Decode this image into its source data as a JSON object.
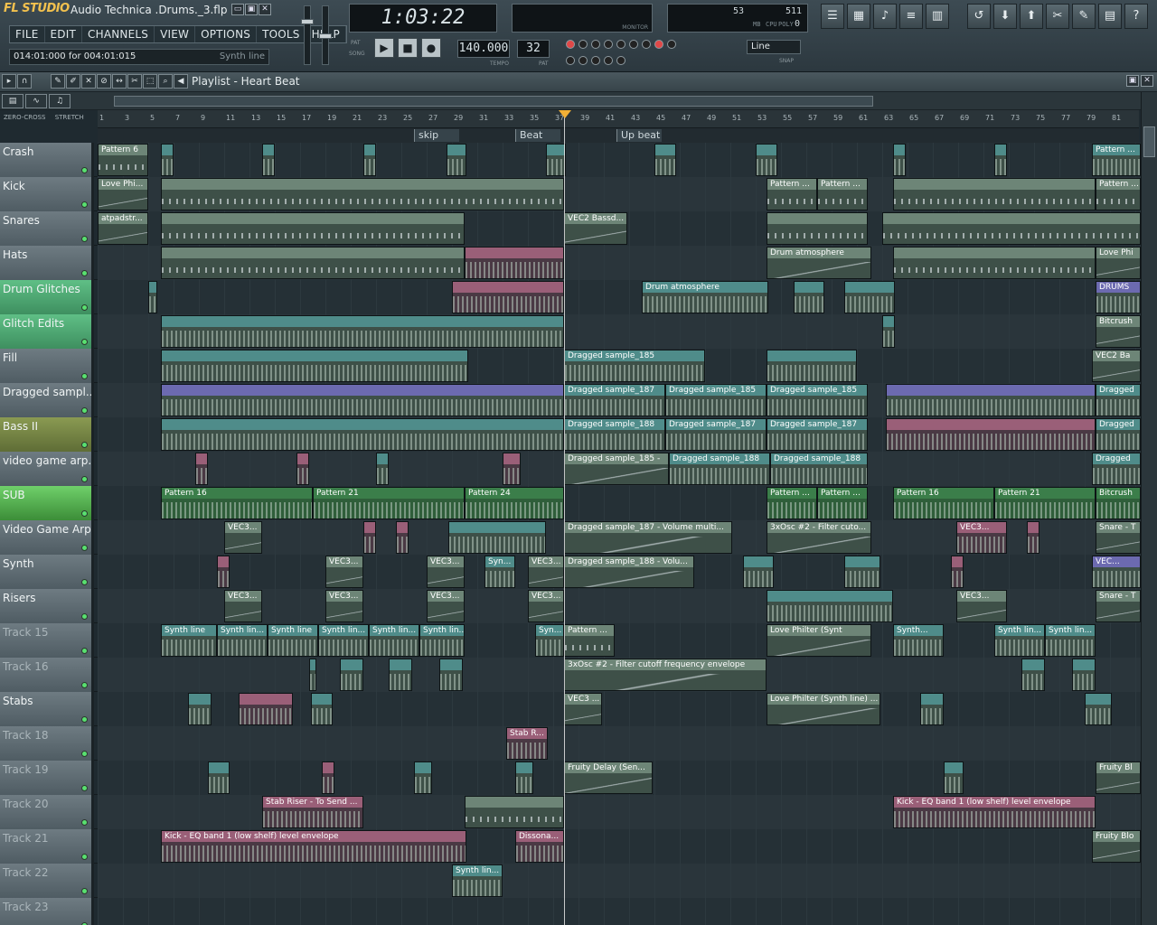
{
  "app": {
    "logo": "FL STUDIO",
    "filename": "Audio Technica .Drums._3.flp"
  },
  "menu": [
    "FILE",
    "EDIT",
    "CHANNELS",
    "VIEW",
    "OPTIONS",
    "TOOLS",
    "HELP"
  ],
  "hint": {
    "text": "014:01:000 for 004:01:015",
    "right": "Synth line"
  },
  "transport": {
    "time": "1:03:22",
    "tempo": "140.000",
    "pattern": "32",
    "tempo_label": "TEMPO",
    "pat_label": "PAT",
    "pat_song_labels": [
      "PAT",
      "SONG"
    ],
    "monitor_label": "MONITOR",
    "cpu_values": [
      "53",
      "511",
      "0"
    ],
    "cpu_labels": [
      "MB",
      "CPU",
      "POLY"
    ],
    "snap_value": "Line",
    "snap_label": "SNAP"
  },
  "playlist": {
    "title": "Playlist - Heart Beat",
    "zero_cross": "ZERO-CROSS",
    "stretch": "STRETCH",
    "markers": [
      {
        "label": "skip",
        "bar": 25
      },
      {
        "label": "Beat Down",
        "bar": 33
      },
      {
        "label": "Up beat",
        "bar": 41
      }
    ],
    "ruler": [
      "1",
      "3",
      "5",
      "7",
      "9",
      "11",
      "13",
      "15",
      "17",
      "19",
      "21",
      "23",
      "25",
      "27",
      "29",
      "31",
      "33",
      "35",
      "37",
      "39",
      "41",
      "43",
      "45",
      "47",
      "49",
      "51",
      "53",
      "55",
      "57",
      "59",
      "61",
      "63",
      "65",
      "67",
      "69",
      "71",
      "73",
      "75",
      "77",
      "79",
      "81"
    ]
  },
  "tracks": [
    {
      "name": "Crash",
      "color": "grey",
      "clips": [
        {
          "label": "Pattern 6",
          "start": 0,
          "len": 56,
          "kind": "pat"
        },
        {
          "label": "",
          "start": 70,
          "len": 14,
          "kind": "teal"
        },
        {
          "label": "",
          "start": 182,
          "len": 14,
          "kind": "teal"
        },
        {
          "label": "",
          "start": 294,
          "len": 14,
          "kind": "teal"
        },
        {
          "label": "",
          "start": 386,
          "len": 22,
          "kind": "teal"
        },
        {
          "label": "",
          "start": 496,
          "len": 22,
          "kind": "teal"
        },
        {
          "label": "",
          "start": 616,
          "len": 24,
          "kind": "teal"
        },
        {
          "label": "",
          "start": 728,
          "len": 24,
          "kind": "teal"
        },
        {
          "label": "",
          "start": 880,
          "len": 14,
          "kind": "teal"
        },
        {
          "label": "",
          "start": 992,
          "len": 14,
          "kind": "teal"
        },
        {
          "label": "Pattern ...",
          "start": 1100,
          "len": 54,
          "kind": "teal"
        }
      ]
    },
    {
      "name": "Kick",
      "color": "grey",
      "clips": [
        {
          "label": "Love Phi...",
          "start": 0,
          "len": 56,
          "kind": "auto"
        },
        {
          "label": "",
          "start": 70,
          "len": 446,
          "kind": "pat"
        },
        {
          "label": "Pattern ...",
          "start": 740,
          "len": 56,
          "kind": "pat"
        },
        {
          "label": "Pattern ...",
          "start": 796,
          "len": 56,
          "kind": "pat"
        },
        {
          "label": "",
          "start": 880,
          "len": 224,
          "kind": "pat"
        },
        {
          "label": "Pattern ...",
          "start": 1104,
          "len": 50,
          "kind": "pat"
        }
      ]
    },
    {
      "name": "Snares",
      "color": "grey",
      "clips": [
        {
          "label": "atpadstr...",
          "start": 0,
          "len": 56,
          "kind": "auto"
        },
        {
          "label": "",
          "start": 70,
          "len": 336,
          "kind": "pat"
        },
        {
          "label": "VEC2 Bassd...",
          "start": 516,
          "len": 70,
          "kind": "auto"
        },
        {
          "label": "",
          "start": 740,
          "len": 112,
          "kind": "pat"
        },
        {
          "label": "",
          "start": 868,
          "len": 286,
          "kind": "pat"
        }
      ]
    },
    {
      "name": "Hats",
      "color": "grey",
      "clips": [
        {
          "label": "",
          "start": 70,
          "len": 336,
          "kind": "pat"
        },
        {
          "label": "",
          "start": 406,
          "len": 110,
          "kind": "pink"
        },
        {
          "label": "Drum atmosphere",
          "start": 740,
          "len": 116,
          "kind": "auto"
        },
        {
          "label": "",
          "start": 880,
          "len": 224,
          "kind": "pat"
        },
        {
          "label": "Love Phi",
          "start": 1104,
          "len": 50,
          "kind": "auto"
        }
      ]
    },
    {
      "name": "Drum Glitches",
      "color": "green",
      "clips": [
        {
          "label": "",
          "start": 56,
          "len": 10,
          "kind": "teal"
        },
        {
          "label": "",
          "start": 392,
          "len": 124,
          "kind": "pink"
        },
        {
          "label": "Drum atmosphere",
          "start": 602,
          "len": 140,
          "kind": "teal"
        },
        {
          "label": "",
          "start": 770,
          "len": 34,
          "kind": "teal"
        },
        {
          "label": "",
          "start": 826,
          "len": 56,
          "kind": "teal"
        },
        {
          "label": "DRUMS",
          "start": 1104,
          "len": 50,
          "kind": "purple"
        }
      ]
    },
    {
      "name": "Glitch Edits",
      "color": "green",
      "clips": [
        {
          "label": "",
          "start": 70,
          "len": 446,
          "kind": "teal"
        },
        {
          "label": "",
          "start": 868,
          "len": 14,
          "kind": "teal"
        },
        {
          "label": "Bitcrush",
          "start": 1104,
          "len": 50,
          "kind": "auto"
        }
      ]
    },
    {
      "name": "Fill",
      "color": "grey",
      "clips": [
        {
          "label": "",
          "start": 70,
          "len": 340,
          "kind": "teal"
        },
        {
          "label": "Dragged sample_185",
          "start": 516,
          "len": 156,
          "kind": "teal"
        },
        {
          "label": "",
          "start": 740,
          "len": 100,
          "kind": "teal"
        },
        {
          "label": "VEC2 Ba",
          "start": 1100,
          "len": 54,
          "kind": "auto"
        }
      ]
    },
    {
      "name": "Dragged sampl...",
      "color": "grey",
      "clips": [
        {
          "label": "",
          "start": 70,
          "len": 446,
          "kind": "purple"
        },
        {
          "label": "Dragged sample_187",
          "start": 516,
          "len": 112,
          "kind": "teal"
        },
        {
          "label": "Dragged sample_185",
          "start": 628,
          "len": 112,
          "kind": "teal"
        },
        {
          "label": "Dragged sample_185",
          "start": 740,
          "len": 112,
          "kind": "teal"
        },
        {
          "label": "",
          "start": 872,
          "len": 232,
          "kind": "purple"
        },
        {
          "label": "Dragged",
          "start": 1104,
          "len": 50,
          "kind": "teal"
        }
      ]
    },
    {
      "name": "Bass II",
      "color": "olive",
      "clips": [
        {
          "label": "",
          "start": 70,
          "len": 446,
          "kind": "teal"
        },
        {
          "label": "Dragged sample_188",
          "start": 516,
          "len": 112,
          "kind": "teal"
        },
        {
          "label": "Dragged sample_187",
          "start": 628,
          "len": 112,
          "kind": "teal"
        },
        {
          "label": "Dragged sample_187",
          "start": 740,
          "len": 112,
          "kind": "teal"
        },
        {
          "label": "",
          "start": 872,
          "len": 232,
          "kind": "pink"
        },
        {
          "label": "Dragged",
          "start": 1104,
          "len": 50,
          "kind": "teal"
        }
      ]
    },
    {
      "name": "video game arp...",
      "color": "pink",
      "clips": [
        {
          "label": "",
          "start": 108,
          "len": 14,
          "kind": "pink"
        },
        {
          "label": "",
          "start": 220,
          "len": 14,
          "kind": "pink"
        },
        {
          "label": "",
          "start": 308,
          "len": 14,
          "kind": "teal"
        },
        {
          "label": "",
          "start": 448,
          "len": 20,
          "kind": "pink"
        },
        {
          "label": "Dragged sample_185 -",
          "start": 516,
          "len": 116,
          "kind": "auto"
        },
        {
          "label": "Dragged sample_188",
          "start": 632,
          "len": 112,
          "kind": "teal"
        },
        {
          "label": "Dragged sample_188",
          "start": 744,
          "len": 108,
          "kind": "teal"
        },
        {
          "label": "Dragged",
          "start": 1100,
          "len": 54,
          "kind": "teal"
        }
      ]
    },
    {
      "name": "SUB",
      "color": "brightgreen",
      "clips": [
        {
          "label": "Pattern 16",
          "start": 70,
          "len": 168,
          "kind": "sub"
        },
        {
          "label": "Pattern 21",
          "start": 238,
          "len": 168,
          "kind": "sub"
        },
        {
          "label": "Pattern 24",
          "start": 406,
          "len": 110,
          "kind": "sub"
        },
        {
          "label": "Pattern ...",
          "start": 740,
          "len": 56,
          "kind": "sub"
        },
        {
          "label": "Pattern ...",
          "start": 796,
          "len": 56,
          "kind": "sub"
        },
        {
          "label": "Pattern 16",
          "start": 880,
          "len": 112,
          "kind": "sub"
        },
        {
          "label": "Pattern 21",
          "start": 992,
          "len": 112,
          "kind": "sub"
        },
        {
          "label": "Bitcrush",
          "start": 1104,
          "len": 50,
          "kind": "sub"
        }
      ]
    },
    {
      "name": "Video Game Arp",
      "color": "grey",
      "clips": [
        {
          "label": "VEC3...",
          "start": 140,
          "len": 42,
          "kind": "auto"
        },
        {
          "label": "",
          "start": 294,
          "len": 14,
          "kind": "pink"
        },
        {
          "label": "",
          "start": 330,
          "len": 14,
          "kind": "pink"
        },
        {
          "label": "",
          "start": 388,
          "len": 108,
          "kind": "teal"
        },
        {
          "label": "Dragged sample_187 - Volume multi...",
          "start": 516,
          "len": 186,
          "kind": "auto"
        },
        {
          "label": "3xOsc #2 - Filter cuto...",
          "start": 740,
          "len": 116,
          "kind": "auto"
        },
        {
          "label": "VEC3...",
          "start": 950,
          "len": 56,
          "kind": "pink"
        },
        {
          "label": "",
          "start": 1028,
          "len": 14,
          "kind": "pink"
        },
        {
          "label": "Snare - T",
          "start": 1104,
          "len": 50,
          "kind": "auto"
        }
      ]
    },
    {
      "name": "Synth",
      "color": "grey",
      "clips": [
        {
          "label": "",
          "start": 132,
          "len": 14,
          "kind": "pink"
        },
        {
          "label": "VEC3...",
          "start": 252,
          "len": 42,
          "kind": "auto"
        },
        {
          "label": "VEC3...",
          "start": 364,
          "len": 42,
          "kind": "auto"
        },
        {
          "label": "Syn...",
          "start": 428,
          "len": 34,
          "kind": "teal"
        },
        {
          "label": "VEC3...",
          "start": 476,
          "len": 40,
          "kind": "auto"
        },
        {
          "label": "Dragged sample_188 - Volu...",
          "start": 516,
          "len": 144,
          "kind": "auto"
        },
        {
          "label": "",
          "start": 714,
          "len": 34,
          "kind": "teal"
        },
        {
          "label": "",
          "start": 826,
          "len": 40,
          "kind": "teal"
        },
        {
          "label": "",
          "start": 944,
          "len": 14,
          "kind": "pink"
        },
        {
          "label": "VEC...",
          "start": 1100,
          "len": 54,
          "kind": "purple"
        }
      ]
    },
    {
      "name": "Risers",
      "color": "grey",
      "clips": [
        {
          "label": "VEC3...",
          "start": 140,
          "len": 42,
          "kind": "auto"
        },
        {
          "label": "VEC3...",
          "start": 252,
          "len": 42,
          "kind": "auto"
        },
        {
          "label": "VEC3...",
          "start": 364,
          "len": 42,
          "kind": "auto"
        },
        {
          "label": "VEC3...",
          "start": 476,
          "len": 40,
          "kind": "auto"
        },
        {
          "label": "",
          "start": 740,
          "len": 140,
          "kind": "teal"
        },
        {
          "label": "VEC3...",
          "start": 950,
          "len": 56,
          "kind": "auto"
        },
        {
          "label": "Snare - T",
          "start": 1104,
          "len": 50,
          "kind": "auto"
        }
      ]
    },
    {
      "name": "Track 15",
      "color": "dim",
      "clips": [
        {
          "label": "Synth line",
          "start": 70,
          "len": 62,
          "kind": "teal"
        },
        {
          "label": "Synth lin...",
          "start": 132,
          "len": 56,
          "kind": "teal"
        },
        {
          "label": "Synth line",
          "start": 188,
          "len": 56,
          "kind": "teal"
        },
        {
          "label": "Synth lin...",
          "start": 244,
          "len": 56,
          "kind": "teal"
        },
        {
          "label": "Synth lin...",
          "start": 300,
          "len": 56,
          "kind": "teal"
        },
        {
          "label": "Synth lin...",
          "start": 356,
          "len": 50,
          "kind": "teal"
        },
        {
          "label": "Syn...",
          "start": 484,
          "len": 32,
          "kind": "teal"
        },
        {
          "label": "Pattern ...",
          "start": 516,
          "len": 56,
          "kind": "pat"
        },
        {
          "label": "Love Philter (Synt",
          "start": 740,
          "len": 116,
          "kind": "auto"
        },
        {
          "label": "Synth...",
          "start": 880,
          "len": 56,
          "kind": "teal"
        },
        {
          "label": "Synth lin...",
          "start": 992,
          "len": 56,
          "kind": "teal"
        },
        {
          "label": "Synth lin...",
          "start": 1048,
          "len": 56,
          "kind": "teal"
        }
      ]
    },
    {
      "name": "Track 16",
      "color": "dim",
      "clips": [
        {
          "label": "",
          "start": 234,
          "len": 8,
          "kind": "teal"
        },
        {
          "label": "",
          "start": 268,
          "len": 26,
          "kind": "teal"
        },
        {
          "label": "",
          "start": 322,
          "len": 26,
          "kind": "teal"
        },
        {
          "label": "",
          "start": 378,
          "len": 26,
          "kind": "teal"
        },
        {
          "label": "3xOsc #2 - Filter cutoff frequency envelope",
          "start": 516,
          "len": 224,
          "kind": "auto"
        },
        {
          "label": "",
          "start": 1022,
          "len": 26,
          "kind": "teal"
        },
        {
          "label": "",
          "start": 1078,
          "len": 26,
          "kind": "teal"
        }
      ]
    },
    {
      "name": "Stabs",
      "color": "grey",
      "clips": [
        {
          "label": "",
          "start": 100,
          "len": 26,
          "kind": "teal"
        },
        {
          "label": "",
          "start": 156,
          "len": 60,
          "kind": "pink"
        },
        {
          "label": "",
          "start": 236,
          "len": 24,
          "kind": "teal"
        },
        {
          "label": "VEC3 ...",
          "start": 516,
          "len": 42,
          "kind": "auto"
        },
        {
          "label": "Love Philter (Synth line) ...",
          "start": 740,
          "len": 126,
          "kind": "auto"
        },
        {
          "label": "",
          "start": 910,
          "len": 26,
          "kind": "teal"
        },
        {
          "label": "",
          "start": 1092,
          "len": 30,
          "kind": "teal"
        }
      ]
    },
    {
      "name": "Track 18",
      "color": "dim",
      "clips": [
        {
          "label": "Stab R...",
          "start": 452,
          "len": 46,
          "kind": "pink"
        }
      ]
    },
    {
      "name": "Track 19",
      "color": "dim",
      "clips": [
        {
          "label": "",
          "start": 122,
          "len": 24,
          "kind": "teal"
        },
        {
          "label": "",
          "start": 248,
          "len": 14,
          "kind": "pink"
        },
        {
          "label": "",
          "start": 350,
          "len": 20,
          "kind": "teal"
        },
        {
          "label": "",
          "start": 462,
          "len": 20,
          "kind": "teal"
        },
        {
          "label": "Fruity Delay (Sen...",
          "start": 516,
          "len": 98,
          "kind": "auto"
        },
        {
          "label": "",
          "start": 936,
          "len": 22,
          "kind": "teal"
        },
        {
          "label": "Fruity Bl",
          "start": 1104,
          "len": 50,
          "kind": "auto"
        }
      ]
    },
    {
      "name": "Track 20",
      "color": "dim",
      "clips": [
        {
          "label": "Stab Riser - To Send ...",
          "start": 182,
          "len": 112,
          "kind": "pink"
        },
        {
          "label": "",
          "start": 406,
          "len": 110,
          "kind": "pat"
        },
        {
          "label": "Kick - EQ band 1 (low shelf) level envelope",
          "start": 880,
          "len": 224,
          "kind": "pink"
        }
      ]
    },
    {
      "name": "Track 21",
      "color": "dim",
      "clips": [
        {
          "label": "Kick - EQ band 1 (low shelf) level envelope",
          "start": 70,
          "len": 338,
          "kind": "pink"
        },
        {
          "label": "Dissona...",
          "start": 462,
          "len": 54,
          "kind": "pink"
        },
        {
          "label": "Fruity Blo",
          "start": 1100,
          "len": 54,
          "kind": "auto"
        }
      ]
    },
    {
      "name": "Track 22",
      "color": "dim",
      "clips": [
        {
          "label": "Synth lin...",
          "start": 392,
          "len": 56,
          "kind": "teal"
        }
      ]
    },
    {
      "name": "Track 23",
      "color": "dim",
      "clips": []
    }
  ]
}
